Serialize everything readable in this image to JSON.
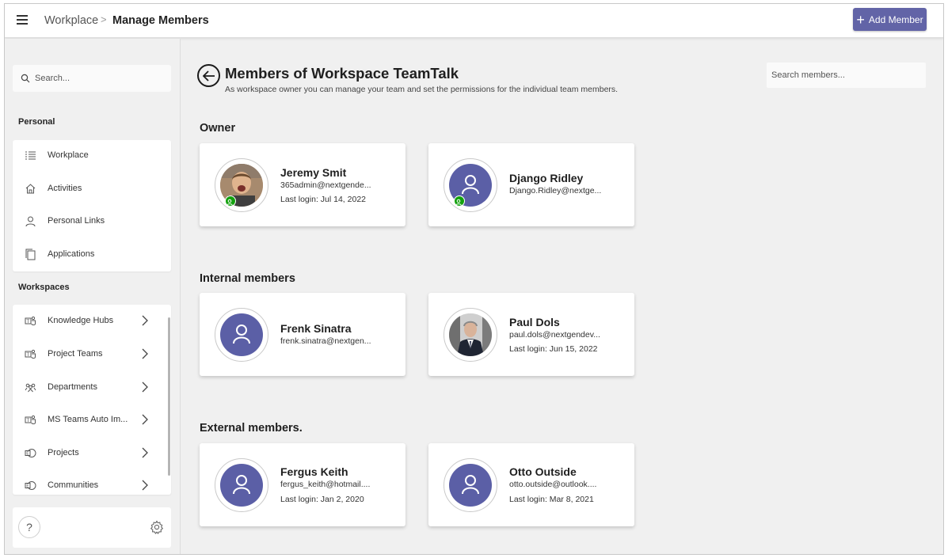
{
  "header": {
    "breadcrumb_root": "Workplace",
    "breadcrumb_separator": ">",
    "breadcrumb_current": "Manage Members",
    "add_member_label": "Add Member"
  },
  "sidebar": {
    "search_placeholder": "Search...",
    "personal_heading": "Personal",
    "personal_items": [
      {
        "label": "Workplace",
        "icon": "list-icon"
      },
      {
        "label": "Activities",
        "icon": "home-icon"
      },
      {
        "label": "Personal Links",
        "icon": "person-icon"
      },
      {
        "label": "Applications",
        "icon": "copy-icon"
      }
    ],
    "workspaces_heading": "Workspaces",
    "workspace_items": [
      {
        "label": "Knowledge Hubs",
        "icon": "teams-icon"
      },
      {
        "label": "Project Teams",
        "icon": "teams-icon"
      },
      {
        "label": "Departments",
        "icon": "people-icon"
      },
      {
        "label": "MS Teams Auto Im...",
        "icon": "teams-icon"
      },
      {
        "label": "Projects",
        "icon": "exchange-icon"
      },
      {
        "label": "Communities",
        "icon": "exchange-icon"
      }
    ],
    "help_label": "?"
  },
  "main": {
    "title": "Members of Workspace TeamTalk",
    "subtitle": "As workspace owner you can manage your team and set the permissions for the individual team members.",
    "search_placeholder": "Search members...",
    "sections": {
      "owner": {
        "title": "Owner",
        "members": [
          {
            "name": "Jeremy Smit",
            "email": "365admin@nextgende...",
            "login": "Last login: Jul 14, 2022"
          },
          {
            "name": "Django Ridley",
            "email": "Django.Ridley@nextge..."
          }
        ]
      },
      "internal": {
        "title": "Internal members",
        "members": [
          {
            "name": "Frenk Sinatra",
            "email": "frenk.sinatra@nextgen..."
          },
          {
            "name": "Paul Dols",
            "email": "paul.dols@nextgendev...",
            "login": "Last login: Jun 15, 2022"
          }
        ]
      },
      "external": {
        "title": "External members.",
        "members": [
          {
            "name": "Fergus Keith",
            "email": "fergus_keith@hotmail....",
            "login": "Last login: Jan 2, 2020"
          },
          {
            "name": "Otto Outside",
            "email": "otto.outside@outlook....",
            "login": "Last login: Mar 8, 2021"
          }
        ]
      }
    }
  },
  "colors": {
    "accent": "#6264a7",
    "avatar_bg": "#5b5fa6",
    "owner_badge": "#13a10e",
    "background": "#f0f0f0"
  }
}
